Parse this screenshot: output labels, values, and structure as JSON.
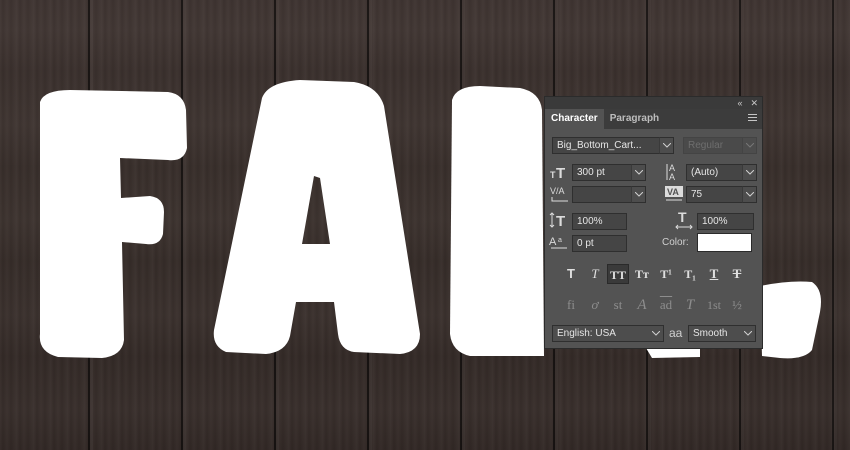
{
  "panel": {
    "tabs": [
      "Character",
      "Paragraph"
    ],
    "active_tab": "Character",
    "titlebar": {
      "collapse": "«",
      "close": "✕"
    },
    "font_family": "Big_Bottom_Cart...",
    "font_style": "Regular",
    "font_size": "300 pt",
    "leading": "(Auto)",
    "kerning": "",
    "tracking": "75",
    "vertical_scale": "100%",
    "horizontal_scale": "100%",
    "baseline_shift": "0 pt",
    "color_label": "Color:",
    "color_value": "#ffffff",
    "type_styles": [
      {
        "glyph": "T",
        "name": "faux-bold"
      },
      {
        "glyph": "T",
        "name": "faux-italic"
      },
      {
        "glyph": "TT",
        "name": "all-caps"
      },
      {
        "glyph": "Tт",
        "name": "small-caps"
      },
      {
        "glyph": "T¹",
        "name": "superscript"
      },
      {
        "glyph": "T₁",
        "name": "subscript"
      },
      {
        "glyph": "T",
        "name": "underline"
      },
      {
        "glyph": "T",
        "name": "strikethrough"
      }
    ],
    "opentype": [
      {
        "glyph": "fi",
        "name": "ligatures"
      },
      {
        "glyph": "ơ",
        "name": "discretionary-ligatures"
      },
      {
        "glyph": "st",
        "name": "old-style"
      },
      {
        "glyph": "A",
        "name": "swash"
      },
      {
        "glyph": "ad",
        "name": "stylistic-alternates"
      },
      {
        "glyph": "T",
        "name": "titling"
      },
      {
        "glyph": "1st",
        "name": "ordinals"
      },
      {
        "glyph": "½",
        "name": "fractions"
      }
    ],
    "language": "English: USA",
    "antialias_label": "aa",
    "antialias": "Smooth"
  },
  "artwork": {
    "text": "FALL",
    "text_color": "#ffffff",
    "background_color": "#3a302c"
  }
}
